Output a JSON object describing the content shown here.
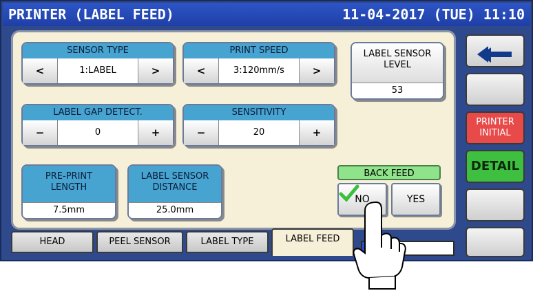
{
  "header": {
    "title": "PRINTER (LABEL FEED)",
    "datetime": "11-04-2017 (TUE) 11:10"
  },
  "sensor_type": {
    "label": "SENSOR TYPE",
    "value": "1:LABEL",
    "prev": "<",
    "next": ">"
  },
  "print_speed": {
    "label": "PRINT SPEED",
    "value": "3:120mm/s",
    "prev": "<",
    "next": ">"
  },
  "label_gap_detect": {
    "label": "LABEL GAP DETECT.",
    "value": "0",
    "dec": "−",
    "inc": "+"
  },
  "sensitivity": {
    "label": "SENSITIVITY",
    "value": "20",
    "dec": "−",
    "inc": "+"
  },
  "label_sensor_level": {
    "label_line1": "LABEL SENSOR",
    "label_line2": "LEVEL",
    "value": "53"
  },
  "pre_print_length": {
    "label_line1": "PRE-PRINT",
    "label_line2": "LENGTH",
    "value": "7.5mm"
  },
  "label_sensor_distance": {
    "label_line1": "LABEL SENSOR",
    "label_line2": "DISTANCE",
    "value": "25.0mm"
  },
  "back_feed": {
    "label": "BACK FEED",
    "no": "NO",
    "yes": "YES",
    "selected": "NO"
  },
  "tabs": [
    {
      "label": "HEAD"
    },
    {
      "label": "PEEL SENSOR"
    },
    {
      "label": "LABEL TYPE"
    },
    {
      "label": "LABEL FEED",
      "active": true
    }
  ],
  "side": {
    "back_icon": "back-arrow-icon",
    "printer_initial_line1": "PRINTER",
    "printer_initial_line2": "INITIAL",
    "detail": "DETAIL"
  },
  "colors": {
    "title_bar": "#2d55c7",
    "panel": "#f6f0d8",
    "group_header": "#47a3cf",
    "back_feed_header": "#8fe38a",
    "printer_initial": "#e84a4a",
    "detail": "#3fbf3f",
    "check": "#3cc03c"
  }
}
